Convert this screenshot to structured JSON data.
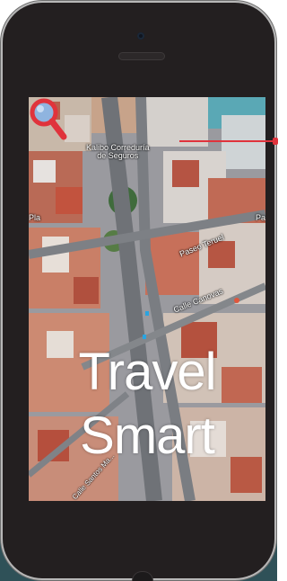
{
  "hero": {
    "title_line1": "Travel",
    "title_line2": "Smart"
  },
  "map": {
    "place_label_line1": "Kalibo Correduría",
    "place_label_line2": "de Seguros",
    "street_teruel": "Paseo Teruel",
    "street_canovas": "Calle Canovas",
    "street_edge_left": "Pla",
    "street_edge_right": "Pa",
    "street_bottom": "Calle Santos Ma..."
  },
  "colors": {
    "accent_red": "#e0333c",
    "magnifier_glass": "#8fb4df",
    "phone_body": "#231f20"
  },
  "icons": {
    "search": "magnifier-icon",
    "place_marker": "map-pin-icon"
  }
}
